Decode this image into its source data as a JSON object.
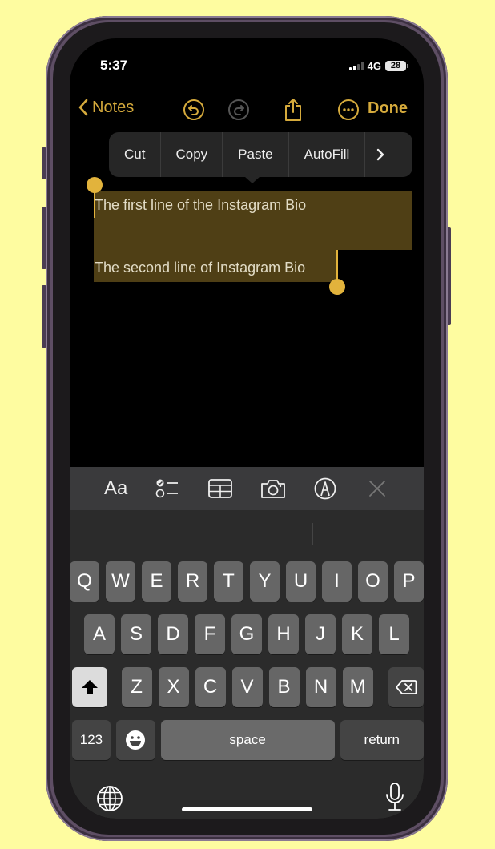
{
  "status_bar": {
    "time": "5:37",
    "network": "4G",
    "battery": "28",
    "signal_bars_active": 2,
    "signal_bars_total": 4
  },
  "nav": {
    "back_label": "Notes",
    "done_label": "Done",
    "icons": [
      "chevron-left-icon",
      "undo-icon",
      "redo-icon",
      "share-icon",
      "more-icon"
    ]
  },
  "edit_menu": {
    "items": [
      "Cut",
      "Copy",
      "Paste",
      "AutoFill"
    ],
    "more": "›"
  },
  "note": {
    "lines": [
      "The first line of the Instagram Bio",
      "The second line of Instagram Bio"
    ]
  },
  "toolbar": {
    "format_label": "Aa",
    "icons": [
      "format-text-icon",
      "checklist-icon",
      "table-icon",
      "camera-icon",
      "markup-pen-icon",
      "close-icon"
    ]
  },
  "keyboard": {
    "row1": [
      "Q",
      "W",
      "E",
      "R",
      "T",
      "Y",
      "U",
      "I",
      "O",
      "P"
    ],
    "row2": [
      "A",
      "S",
      "D",
      "F",
      "G",
      "H",
      "J",
      "K",
      "L"
    ],
    "row3": [
      "Z",
      "X",
      "C",
      "V",
      "B",
      "N",
      "M"
    ],
    "numbers_label": "123",
    "space_label": "space",
    "return_label": "return"
  },
  "colors": {
    "accent": "#d5aa3c",
    "selection": "#4f3f15",
    "background": "#fefca0"
  }
}
